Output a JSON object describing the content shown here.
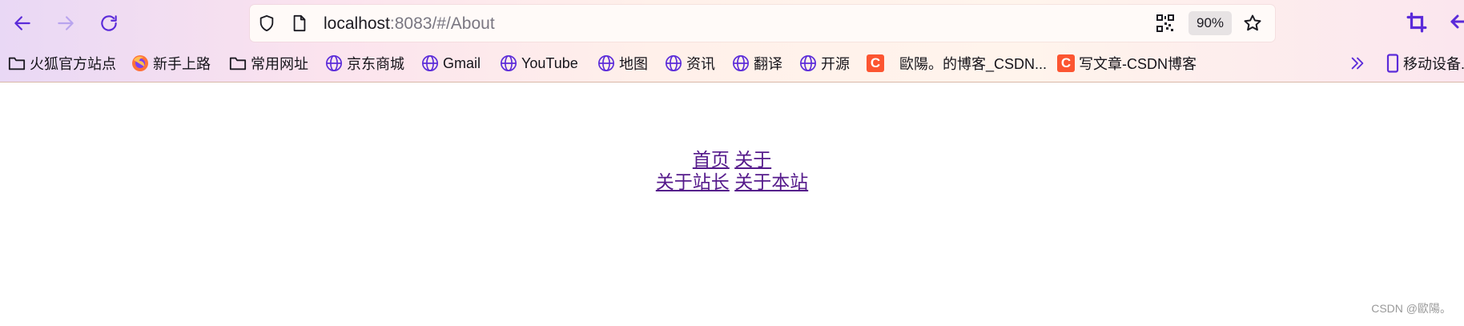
{
  "browser": {
    "url_host": "localhost",
    "url_rest": ":8083/#/About",
    "zoom": "90%",
    "accent_color": "#5b2bd9"
  },
  "bookmarks": [
    {
      "label": "火狐官方站点",
      "icon": "folder-icon"
    },
    {
      "label": "新手上路",
      "icon": "firefox-icon"
    },
    {
      "label": "常用网址",
      "icon": "folder-icon"
    },
    {
      "label": "京东商城",
      "icon": "globe-icon"
    },
    {
      "label": "Gmail",
      "icon": "globe-icon"
    },
    {
      "label": "YouTube",
      "icon": "globe-icon"
    },
    {
      "label": "地图",
      "icon": "globe-icon"
    },
    {
      "label": "资讯",
      "icon": "globe-icon"
    },
    {
      "label": "翻译",
      "icon": "globe-icon"
    },
    {
      "label": "开源",
      "icon": "globe-icon"
    },
    {
      "label": "歐陽。的博客_CSDN...",
      "icon": "csdn-icon",
      "icon_text": "C"
    },
    {
      "label": "写文章-CSDN博客",
      "icon": "csdn-icon",
      "icon_text": "C"
    },
    {
      "label": "移动设备...",
      "icon": "mobile-icon"
    }
  ],
  "page": {
    "nav_top": [
      {
        "label": "首页"
      },
      {
        "label": "关于"
      }
    ],
    "nav_sub": [
      {
        "label": "关于站长"
      },
      {
        "label": "关于本站"
      }
    ],
    "link_color": "#551a8b",
    "watermark": "CSDN @歐陽。"
  }
}
